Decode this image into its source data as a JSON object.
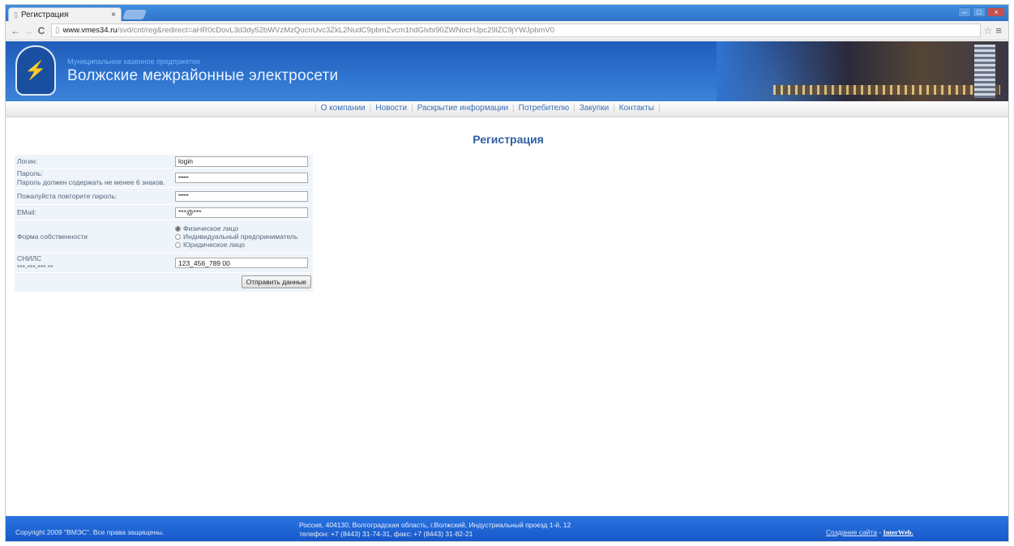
{
  "browser": {
    "tab_title": "Регистрация",
    "tab_close": "×",
    "url_domain": "www.vmes34.ru",
    "url_path": "/svd/cnt/reg&redirect=aHR0cDovL3d3dy52bWVzMzQucnUvc3ZkL2NudC9pbmZvcm1hdGlvbi90ZWNocHJpc29lZC9jYWJpbmV0",
    "back": "←",
    "forward": "→",
    "reload": "C",
    "star": "☆",
    "menu": "≡",
    "win_min": "–",
    "win_max": "□",
    "win_close": "×"
  },
  "header": {
    "org_type": "Муниципальное казенное предприятие",
    "org_name": "Волжские межрайонные электросети"
  },
  "nav": {
    "items": [
      "О компании",
      "Новости",
      "Раскрытие информации",
      "Потребителю",
      "Закупки",
      "Контакты"
    ]
  },
  "page": {
    "title": "Регистрация"
  },
  "form": {
    "login_label": "Логин:",
    "login_value": "login",
    "password_label": "Пароль:",
    "password_hint": "Пароль должен содержать не менее 6 знаков.",
    "password_value": "••••••",
    "password2_label": "Пожалуйста повторите пароль:",
    "password2_value": "••••••",
    "email_label": "EMail:",
    "email_value": "***@***",
    "ownership_label": "Форма собственности",
    "ownership_options": [
      "Физическое лицо",
      "Индивидуальный предприниматель",
      "Юридическое лицо"
    ],
    "snils_label": "СНИЛС",
    "snils_hint": "***-***-*** **",
    "snils_value": "123_456_789 00",
    "submit_label": "Отправить данные"
  },
  "footer": {
    "copyright": "Copyright 2009 \"ВМЭС\". Все права защищены.",
    "address_line1": "Россия, 404130, Волгоградская область, г.Волжский, Индустриальный проезд 1-й, 12",
    "address_line2": "телефон: +7 (8443) 31-74-31, факс: +7 (8443) 31-82-21",
    "credit_link": "Создание сайта",
    "credit_sep": " - ",
    "credit_brand": "InterWeb."
  },
  "colors": {
    "header_blue": "#2f74d0",
    "footer_blue": "#1f64d4",
    "title_blue": "#2f5fa5"
  }
}
